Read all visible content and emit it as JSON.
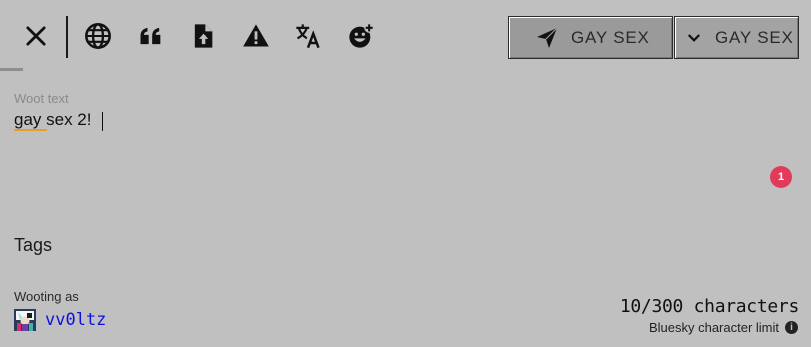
{
  "toolbar": {
    "icons": [
      "close-icon",
      "globe-icon",
      "quote-icon",
      "file-upload-icon",
      "warning-icon",
      "translate-icon",
      "add-emoji-icon"
    ],
    "send_label": "GAY SEX",
    "menu_label": "GAY SEX"
  },
  "composer": {
    "field_label": "Woot text",
    "text": "gay sex 2!",
    "badge_count": "1"
  },
  "tags": {
    "heading": "Tags"
  },
  "account": {
    "label": "Wooting as",
    "username": "vv0ltz"
  },
  "counter": {
    "count": "10/300 characters",
    "limit_label": "Bluesky character limit",
    "info_glyph": "i"
  },
  "colors": {
    "background": "#c0c0c0",
    "username": "#1010e0",
    "badge": "#e23a5a",
    "spellcheck": "#e0a030"
  }
}
